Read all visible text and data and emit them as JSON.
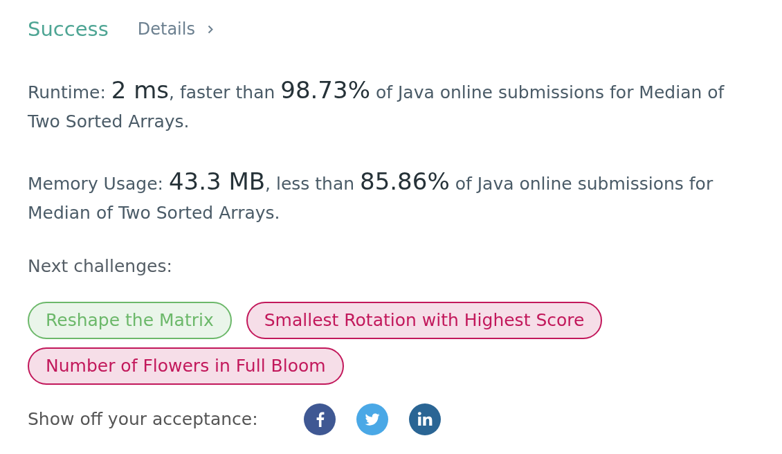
{
  "result": {
    "status": "Success",
    "details_link": "Details"
  },
  "stats": [
    {
      "label": "Runtime:",
      "value": "2 ms",
      "comparison": ", faster than",
      "percent": "98.73%",
      "tail": "of Java online submissions for Median of Two Sorted Arrays."
    },
    {
      "label": "Memory Usage:",
      "value": "43.3 MB",
      "comparison": ", less than",
      "percent": "85.86%",
      "tail": "of Java online submissions for Median of Two Sorted Arrays."
    }
  ],
  "next_challenges": {
    "heading": "Next challenges:",
    "items": [
      {
        "title": "Reshape the Matrix",
        "color": "#6cb86a"
      },
      {
        "title": "Smallest Rotation with Highest Score",
        "color": "#c2185b"
      },
      {
        "title": "Number of Flowers in Full Bloom",
        "color": "#c2185b"
      }
    ]
  },
  "share": {
    "label": "Show off your acceptance:"
  }
}
